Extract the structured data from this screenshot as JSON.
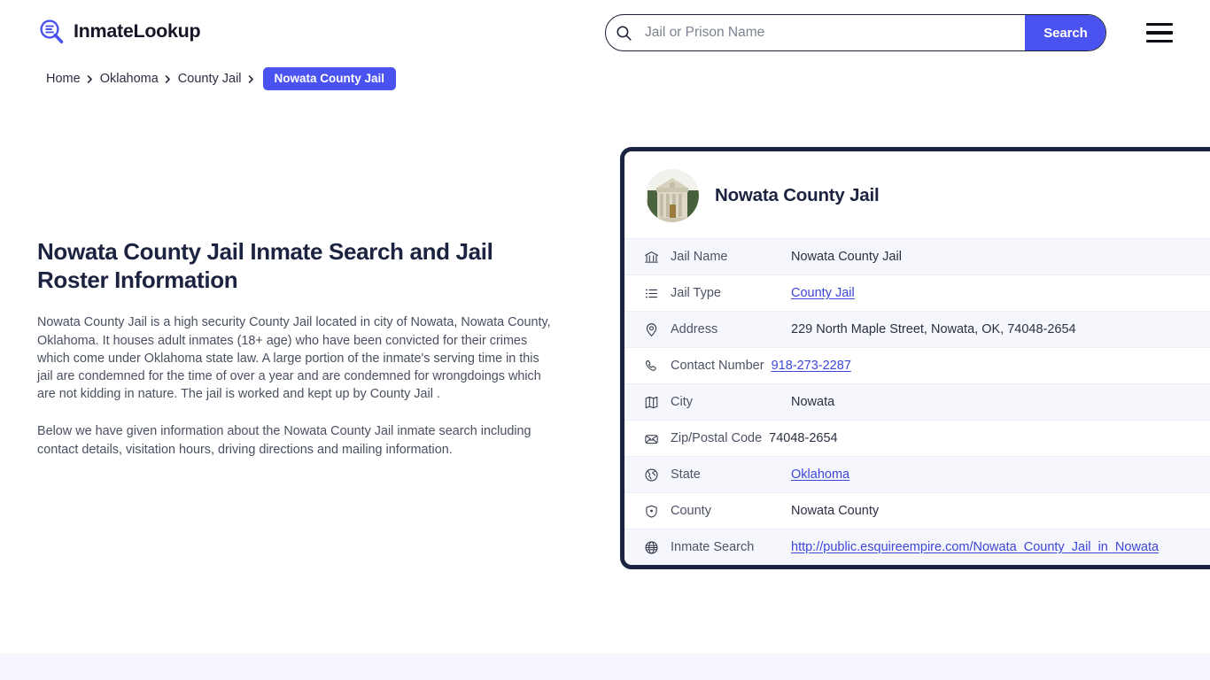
{
  "header": {
    "brand_name": "InmateLookup",
    "brand_icon": "magnifier-list-icon",
    "search": {
      "placeholder": "Jail or Prison Name",
      "value": "",
      "icon": "search-icon",
      "button_label": "Search"
    },
    "menu_icon": "hamburger-menu-icon"
  },
  "breadcrumb": {
    "items": [
      {
        "label": "Home",
        "current": false
      },
      {
        "label": "Oklahoma",
        "current": false
      },
      {
        "label": "County Jail",
        "current": false
      },
      {
        "label": "Nowata County Jail",
        "current": true
      }
    ],
    "separator_icon": "chevron-right-icon"
  },
  "main": {
    "title": "Nowata County Jail Inmate Search and Jail Roster Information",
    "paragraphs": [
      "Nowata County Jail is a high security County Jail located in city of Nowata, Nowata County, Oklahoma. It houses adult inmates (18+ age) who have been convicted for their crimes which come under Oklahoma state law. A large portion of the inmate's serving time in this jail are condemned for the time of over a year and are condemned for wrongdoings which are not kidding in nature. The jail is worked and kept up by County Jail .",
      "Below we have given information about the Nowata County Jail inmate search including contact details, visitation hours, driving directions and mailing information."
    ]
  },
  "info_card": {
    "thumbnail_icon": "courthouse-building-photo",
    "title": "Nowata County Jail",
    "rows": [
      {
        "icon": "bank-landmark-icon",
        "label": "Jail Name",
        "value": "Nowata County Jail",
        "link": false,
        "shade": "alt"
      },
      {
        "icon": "list-icon",
        "label": "Jail Type",
        "value": "County Jail",
        "link": true,
        "shade": "plain"
      },
      {
        "icon": "map-pin-icon",
        "label": "Address",
        "value": "229 North Maple Street, Nowata, OK, 74048-2654",
        "link": false,
        "shade": "alt"
      },
      {
        "icon": "phone-icon",
        "label": "Contact Number",
        "value": "918-273-2287",
        "link": true,
        "shade": "plain"
      },
      {
        "icon": "map-icon",
        "label": "City",
        "value": "Nowata",
        "link": false,
        "shade": "alt"
      },
      {
        "icon": "envelope-icon",
        "label": "Zip/Postal Code",
        "value": "74048-2654",
        "link": false,
        "shade": "plain"
      },
      {
        "icon": "globe-americas-icon",
        "label": "State",
        "value": "Oklahoma",
        "link": true,
        "shade": "alt"
      },
      {
        "icon": "shield-badge-icon",
        "label": "County",
        "value": "Nowata County",
        "link": false,
        "shade": "plain"
      },
      {
        "icon": "globe-icon",
        "label": "Inmate Search",
        "value": "http://public.esquireempire.com/Nowata_County_Jail_in_Nowata",
        "link": true,
        "shade": "alt"
      }
    ]
  },
  "colors": {
    "accent": "#4a52f0",
    "link": "#3c46d8",
    "card_border": "#1b2440",
    "heading": "#1c2340",
    "body_text": "#4a5060",
    "row_alt": "#f6f7fc",
    "footer_strip": "#f5f5fd"
  }
}
